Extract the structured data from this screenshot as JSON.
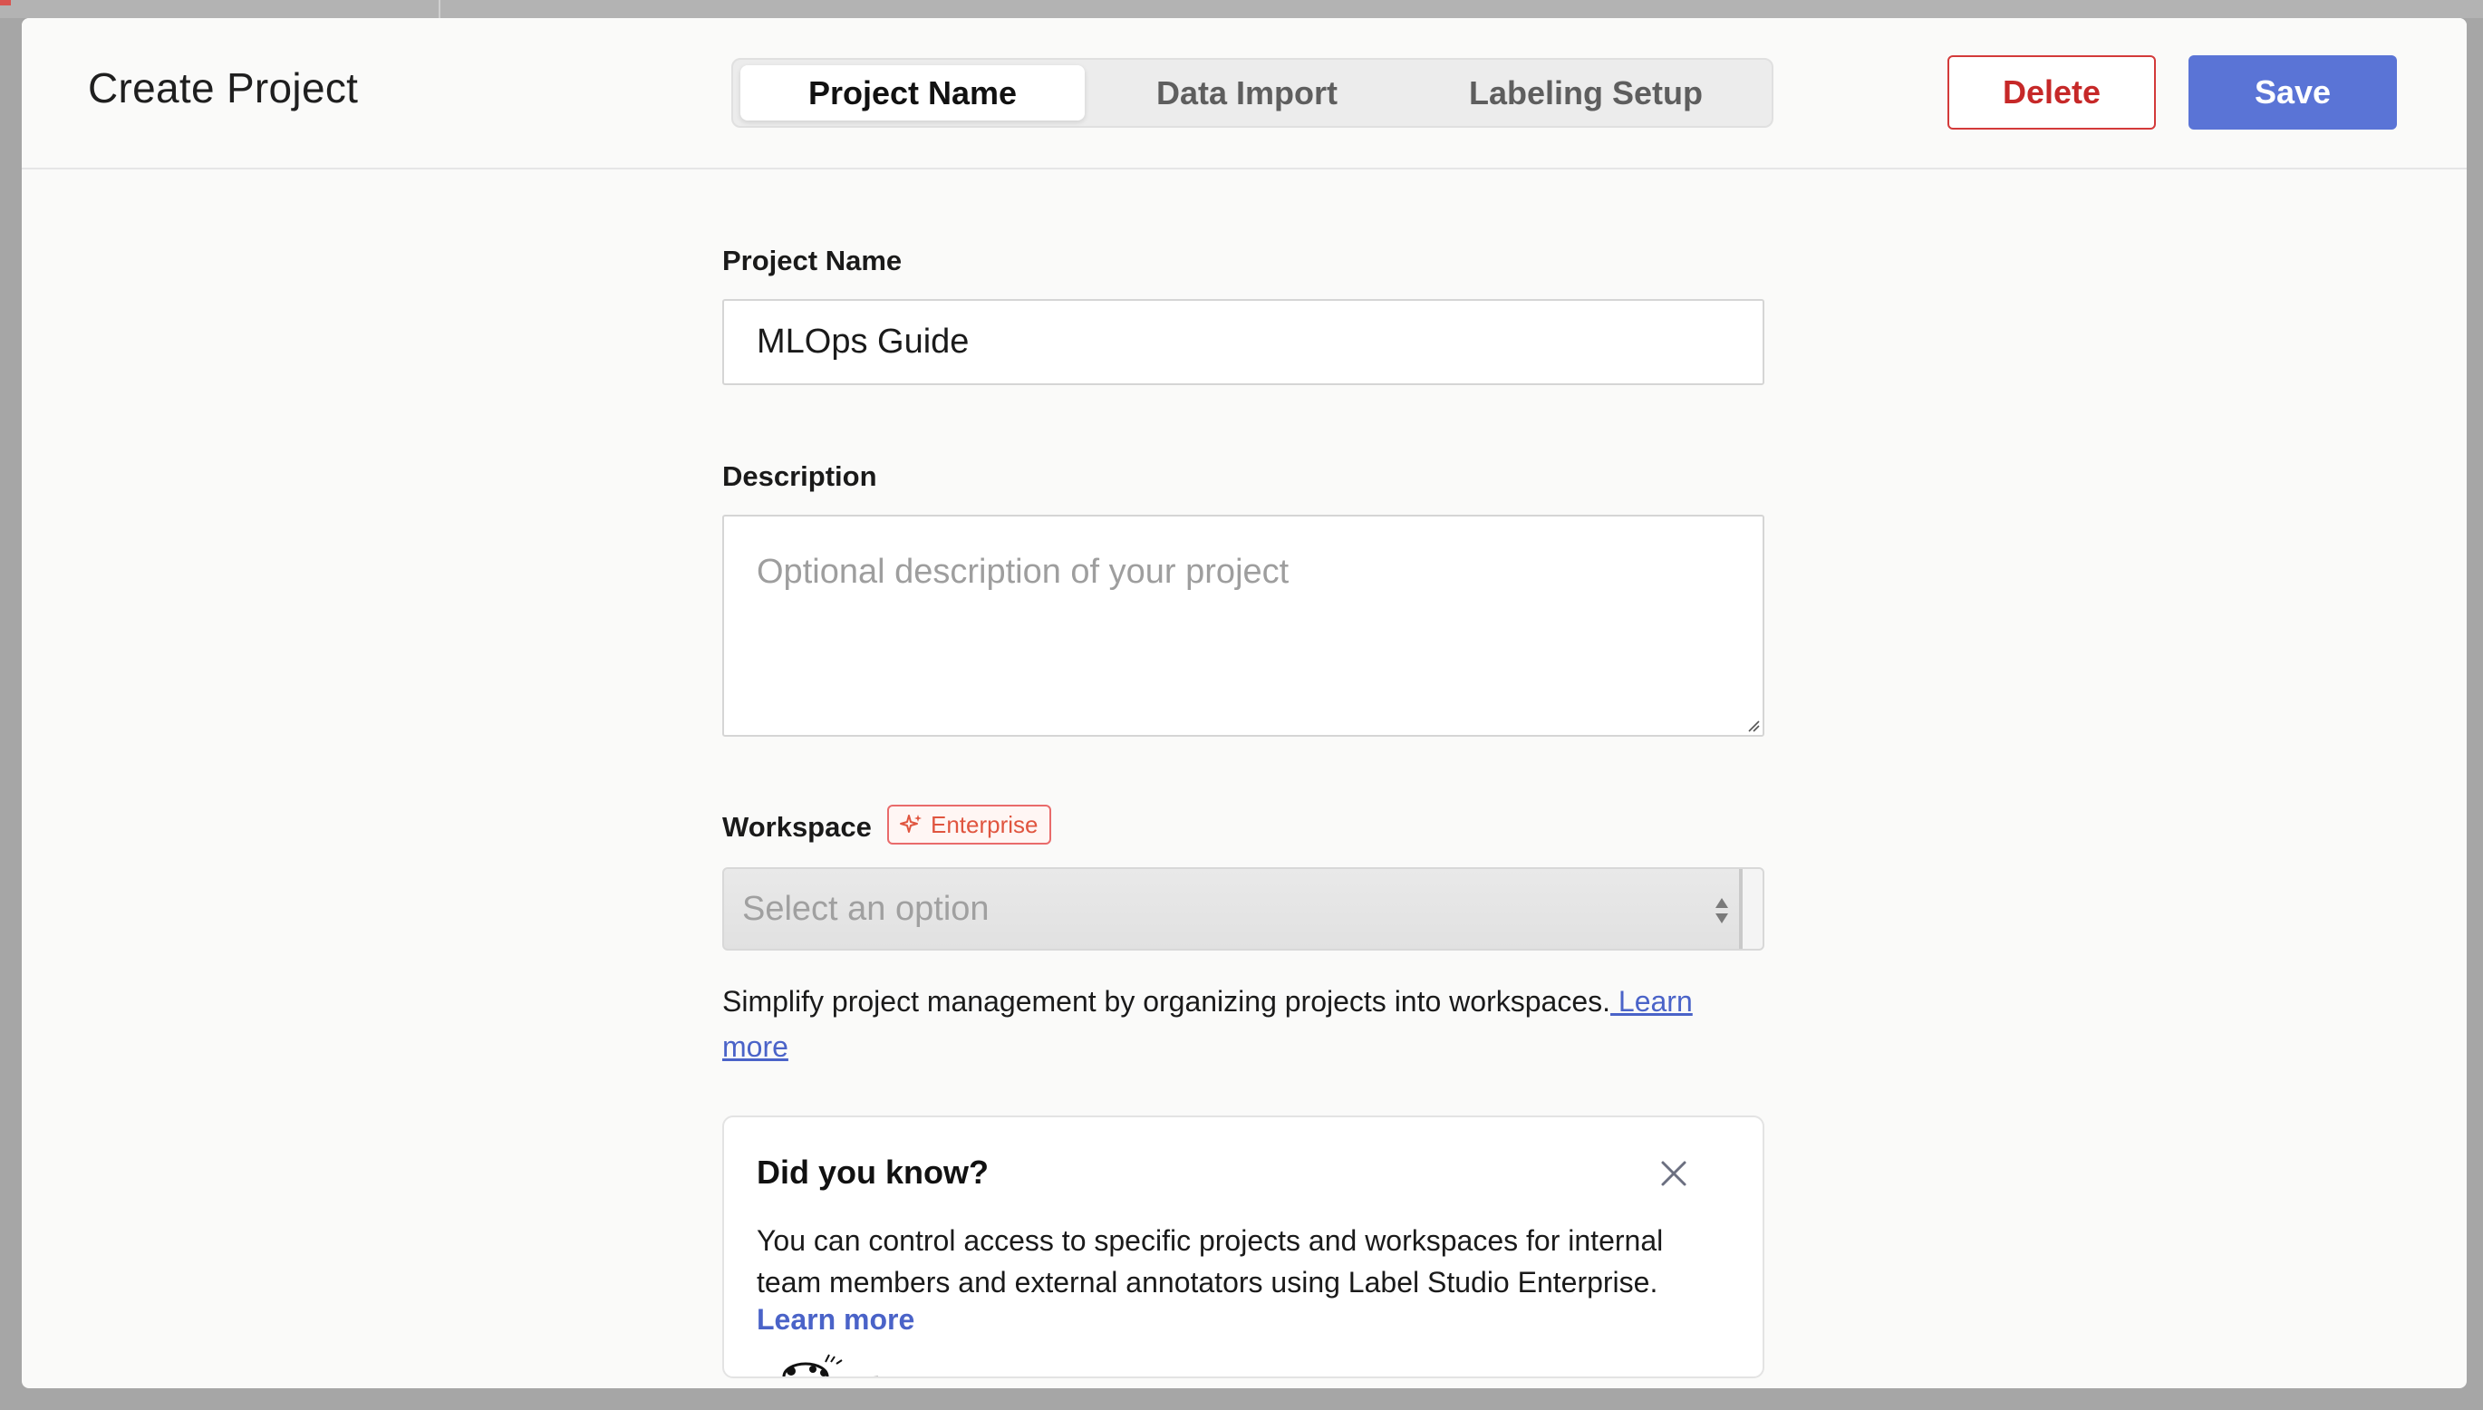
{
  "dialog": {
    "title": "Create Project",
    "tabs": [
      {
        "label": "Project Name",
        "active": true
      },
      {
        "label": "Data Import",
        "active": false
      },
      {
        "label": "Labeling Setup",
        "active": false
      }
    ],
    "delete_label": "Delete",
    "save_label": "Save"
  },
  "form": {
    "name_label": "Project Name",
    "name_value": "MLOps Guide",
    "description_label": "Description",
    "description_placeholder": "Optional description of your project",
    "workspace_label": "Workspace",
    "enterprise_badge": "Enterprise",
    "workspace_select": "Select an option",
    "workspace_help": "Simplify project management by organizing projects into workspaces.",
    "workspace_help_link": " Learn more"
  },
  "tip": {
    "heading": "Did you know?",
    "body": "You can control access to specific projects and workspaces for internal team members and external annotators using Label Studio Enterprise.",
    "link": "Learn more"
  },
  "colors": {
    "primary": "#5a74d6",
    "danger": "#c62828",
    "enterprise": "#e0553f"
  },
  "icons": {
    "badge": "sparkle-icon",
    "close": "close-icon",
    "select_arrows": "updown-arrows-icon"
  }
}
